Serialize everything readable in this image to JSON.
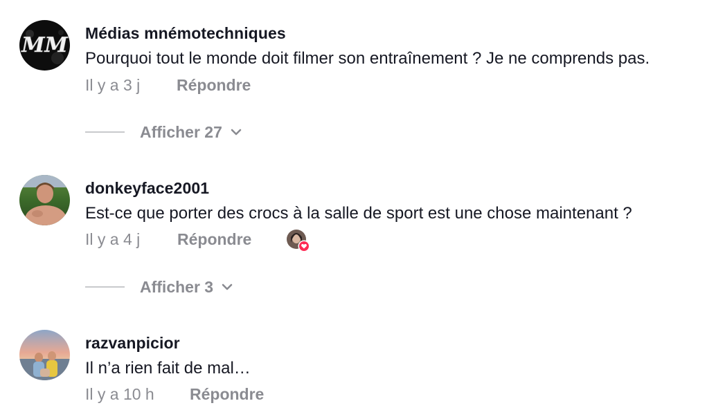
{
  "comments": [
    {
      "username": "Médias mnémotechniques",
      "text": "Pourquoi tout le monde doit filmer son entraînement ? Je ne comprends pas.",
      "time": "Il y a 3 j",
      "reply_label": "Répondre",
      "view_replies_label": "Afficher 27",
      "avatar_initials": "MM"
    },
    {
      "username": "donkeyface2001",
      "text": "Est-ce que porter des crocs à la salle de sport est une chose maintenant ?",
      "time": "Il y a 4 j",
      "reply_label": "Répondre",
      "view_replies_label": "Afficher 3"
    },
    {
      "username": "razvanpicior",
      "text": "Il n’a rien fait de mal…",
      "time": "Il y a 10 h",
      "reply_label": "Répondre"
    }
  ],
  "colors": {
    "text_primary": "#161823",
    "text_secondary": "#8a8b91",
    "like_badge": "#fe2c55"
  }
}
